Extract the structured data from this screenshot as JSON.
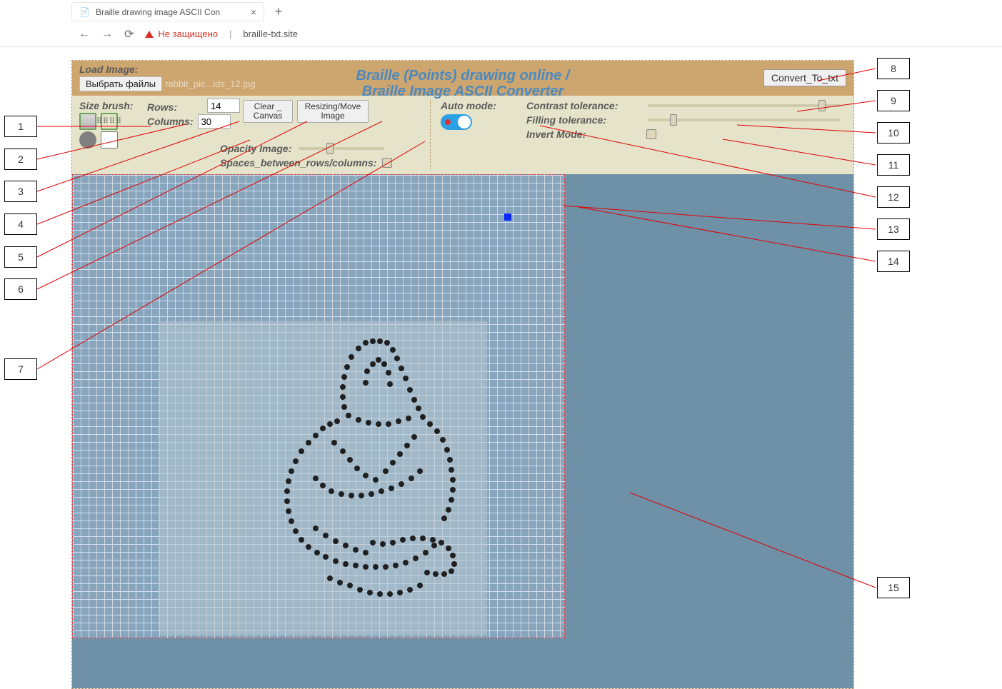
{
  "browser": {
    "tab_title": "Braille drawing image ASCII Con",
    "not_secure_label": "Не защищено",
    "url_text": "braille-txt.site"
  },
  "header": {
    "load_image_label": "Load Image:",
    "choose_files_label": "Выбрать файлы",
    "file_name": "rabbit_pic...ids_12.jpg",
    "title_line1": "Braille (Points) drawing online /",
    "title_line2": "Braille Image ASCII Converter",
    "convert_button": "Convert_To_txt"
  },
  "controls": {
    "size_brush_label": "Size brush:",
    "rows_label": "Rows:",
    "rows_value": "14",
    "columns_label": "Columns:",
    "columns_value": "30",
    "clear_canvas_label": "Clear _\nCanvas",
    "resize_move_label": "Resizing/Move\nImage",
    "opacity_label": "Opacity Image:",
    "spaces_label": "Spaces_between_rows/columns:",
    "auto_mode_label": "Auto mode:",
    "contrast_label": "Contrast tolerance:",
    "filling_label": "Filling tolerance:",
    "invert_label": "Invert Mode:",
    "auto_mode_on": true,
    "opacity_value": 35,
    "contrast_value": 92,
    "filling_value": 12,
    "invert_checked": false,
    "spaces_checked": false
  },
  "callouts": {
    "c1": "1",
    "c2": "2",
    "c3": "3",
    "c4": "4",
    "c5": "5",
    "c6": "6",
    "c7": "7",
    "c8": "8",
    "c9": "9",
    "c10": "10",
    "c11": "11",
    "c12": "12",
    "c13": "13",
    "c14": "14",
    "c15": "15"
  }
}
